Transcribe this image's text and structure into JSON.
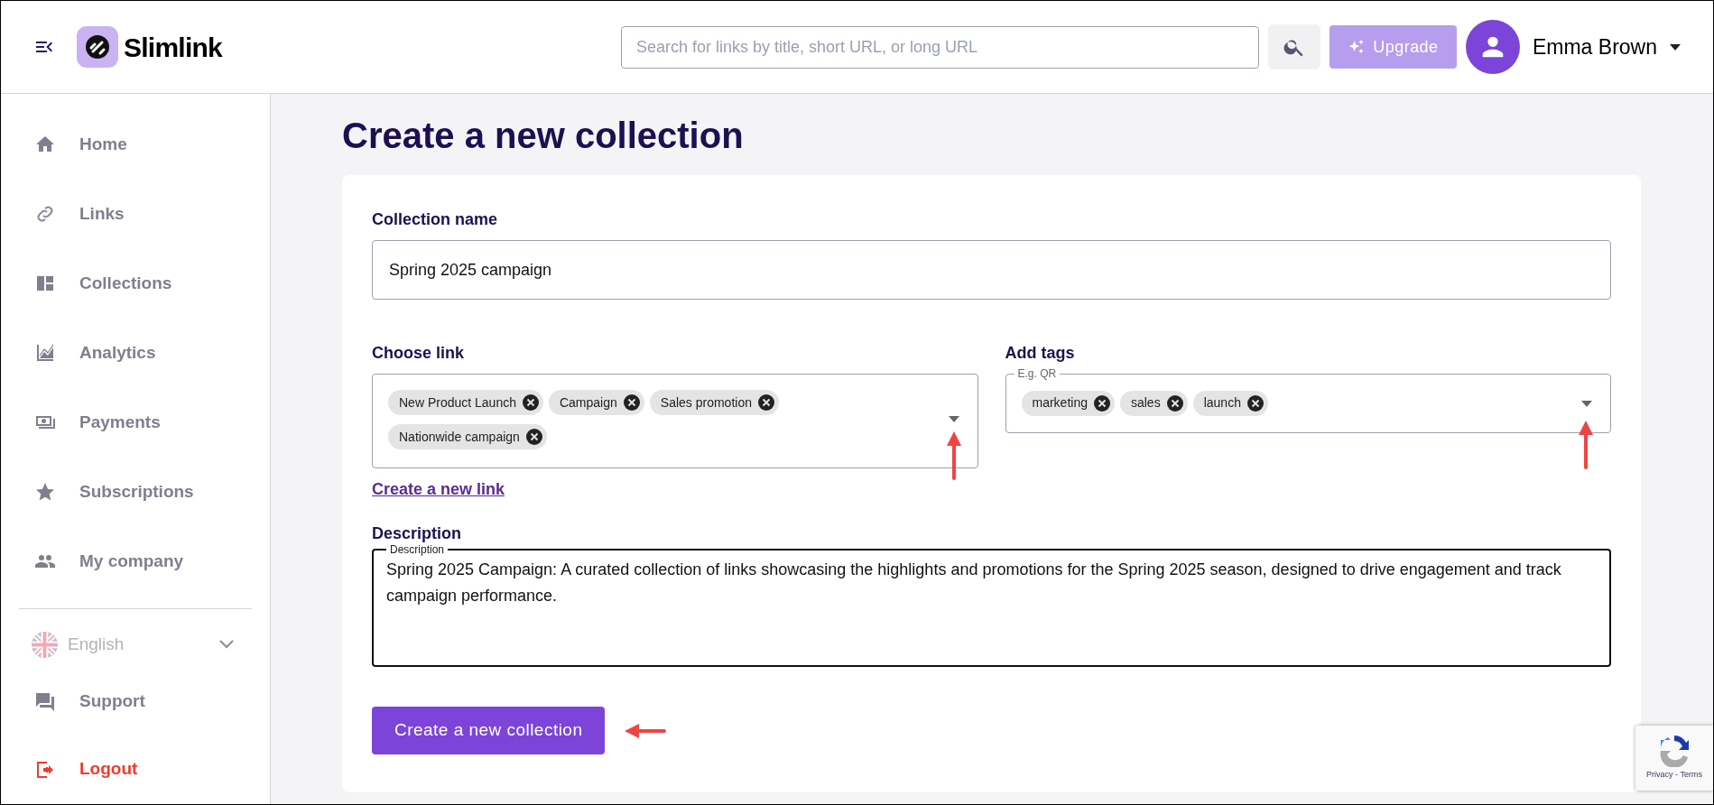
{
  "header": {
    "brand": "Slimlink",
    "search": {
      "placeholder": "Search for links by title, short URL, or long URL"
    },
    "upgrade": "Upgrade",
    "user": "Emma Brown"
  },
  "sidebar": {
    "items": [
      {
        "kind": "nav",
        "label": "Home"
      },
      {
        "kind": "nav",
        "label": "Links"
      },
      {
        "kind": "nav",
        "label": "Collections"
      },
      {
        "kind": "nav",
        "label": "Analytics"
      },
      {
        "kind": "nav",
        "label": "Payments"
      },
      {
        "kind": "nav",
        "label": "Subscriptions"
      },
      {
        "kind": "nav",
        "label": "My company"
      },
      {
        "kind": "language",
        "label": "English"
      },
      {
        "kind": "nav",
        "label": "Support"
      },
      {
        "kind": "logout",
        "label": "Logout"
      }
    ]
  },
  "page": {
    "title": "Create a new collection",
    "collection_name": {
      "label": "Collection name",
      "value": "Spring 2025 campaign"
    },
    "choose_link": {
      "label": "Choose link",
      "chips": [
        "New Product Launch",
        "Campaign",
        "Sales promotion",
        "Nationwide campaign"
      ],
      "link": "Create a new link"
    },
    "add_tags": {
      "label": "Add tags",
      "placeholder": "E.g. QR",
      "chips": [
        "marketing",
        "sales",
        "launch"
      ]
    },
    "description": {
      "label": "Description",
      "legend": "Description",
      "value": "Spring 2025 Campaign: A curated collection of links showcasing the highlights and promotions for the Spring 2025 season, designed to drive engagement and track campaign performance."
    },
    "submit": "Create a new collection"
  },
  "recaptcha": {
    "text": "Privacy - Terms"
  }
}
